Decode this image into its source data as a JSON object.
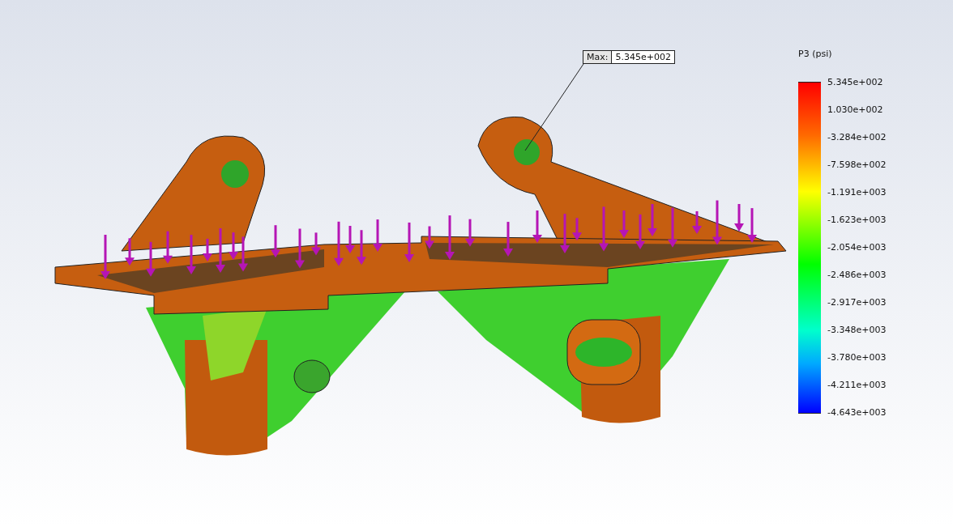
{
  "probe": {
    "label": "Max:",
    "value": "5.345e+002"
  },
  "legend": {
    "title": "P3 (psi)",
    "labels": [
      "5.345e+002",
      "1.030e+002",
      "-3.284e+002",
      "-7.598e+002",
      "-1.191e+003",
      "-1.623e+003",
      "-2.054e+003",
      "-2.486e+003",
      "-2.917e+003",
      "-3.348e+003",
      "-3.780e+003",
      "-4.211e+003",
      "-4.643e+003"
    ]
  }
}
